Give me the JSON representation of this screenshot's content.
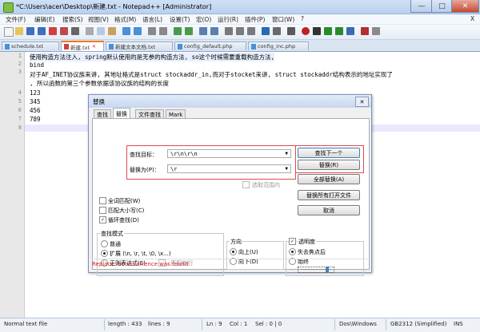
{
  "window": {
    "title": "*C:\\Users\\acer\\Desktop\\新建.txt - Notepad++ [Administrator]"
  },
  "menu": [
    "文件(F)",
    "编辑(E)",
    "搜索(S)",
    "视图(V)",
    "格式(M)",
    "语言(L)",
    "设置(T)",
    "宏(O)",
    "运行(R)",
    "插件(P)",
    "窗口(W)",
    "?",
    "X"
  ],
  "tabs": [
    {
      "label": "schedule.txt",
      "active": false
    },
    {
      "label": "新建.txt",
      "active": true
    },
    {
      "label": "新建文本文档.txt",
      "active": false
    },
    {
      "label": "config_default.php",
      "active": false
    },
    {
      "label": "config_inc.php",
      "active": false
    }
  ],
  "editor": {
    "line_numbers": [
      "1",
      "2",
      "3",
      "",
      "4",
      "5",
      "6",
      "7",
      "8"
    ],
    "lines": [
      "使用构造方法注入, spring默认使用的是无参的构造方法, so这个时候需要重载构造方法,",
      "bind",
      "对于AF_INET协议族来讲, 其地址格式是struct stockaddr_in,而对于stocket来讲, struct stockaddr结构表示的地址实现了",
      ", 所以函数的第三个参数依据该协议族的结构的长度",
      "123",
      "345",
      "456",
      "789",
      ""
    ]
  },
  "dialog": {
    "title": "替换",
    "tabs": [
      "查找",
      "替换",
      "文件查找",
      "Mark"
    ],
    "find_label": "查找目标：",
    "find_value": "\\r\\n\\r\\n",
    "replace_label": "替换为(P)：",
    "replace_value": "\\r",
    "in_selection": "选取范围内",
    "buttons": {
      "find_next": "查找下一个",
      "replace": "替换(R)",
      "replace_all": "全部替换(A)",
      "replace_all_open": "替换所有打开文件",
      "cancel": "取消"
    },
    "options": {
      "whole_word": "全词匹配(W)",
      "match_case": "匹配大小写(C)",
      "wrap_around": "循环查找(D)"
    },
    "search_mode": {
      "label": "查找模式",
      "normal": "普通",
      "extended": "扩展 (\\n, \\r, \\t, \\0, \\x...)",
      "regex": "正则表达式(E)",
      "dot_newline": ". 匹配新行"
    },
    "direction": {
      "label": "方向",
      "up": "向上(U)",
      "down": "向下(D)"
    },
    "transparency": {
      "label": "透明度",
      "on_lose_focus": "失去焦点后",
      "always": "始终"
    },
    "status": "Replace: no occurrence was found."
  },
  "statusbar": {
    "file_type": "Normal text file",
    "length": "length : 433",
    "lines": "lines : 9",
    "ln": "Ln : 9",
    "col": "Col : 1",
    "sel": "Sel : 0 | 0",
    "eol": "Dos\\Windows",
    "encoding": "GB2312 (Simplified)",
    "mode": "INS"
  }
}
